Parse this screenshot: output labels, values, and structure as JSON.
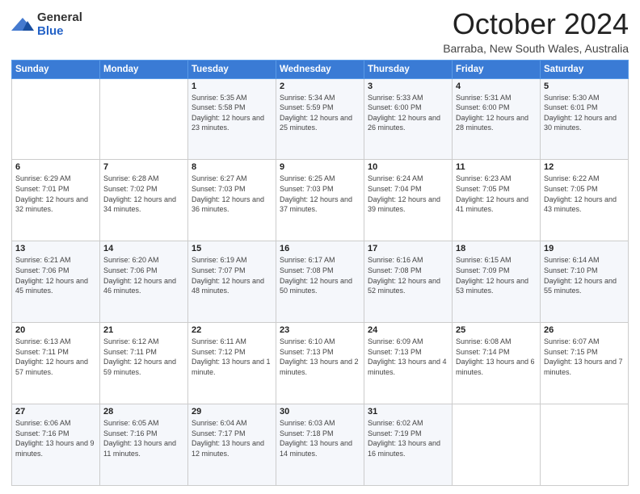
{
  "logo": {
    "general": "General",
    "blue": "Blue"
  },
  "header": {
    "month": "October 2024",
    "location": "Barraba, New South Wales, Australia"
  },
  "days_of_week": [
    "Sunday",
    "Monday",
    "Tuesday",
    "Wednesday",
    "Thursday",
    "Friday",
    "Saturday"
  ],
  "weeks": [
    [
      {
        "day": "",
        "sunrise": "",
        "sunset": "",
        "daylight": ""
      },
      {
        "day": "",
        "sunrise": "",
        "sunset": "",
        "daylight": ""
      },
      {
        "day": "1",
        "sunrise": "Sunrise: 5:35 AM",
        "sunset": "Sunset: 5:58 PM",
        "daylight": "Daylight: 12 hours and 23 minutes."
      },
      {
        "day": "2",
        "sunrise": "Sunrise: 5:34 AM",
        "sunset": "Sunset: 5:59 PM",
        "daylight": "Daylight: 12 hours and 25 minutes."
      },
      {
        "day": "3",
        "sunrise": "Sunrise: 5:33 AM",
        "sunset": "Sunset: 6:00 PM",
        "daylight": "Daylight: 12 hours and 26 minutes."
      },
      {
        "day": "4",
        "sunrise": "Sunrise: 5:31 AM",
        "sunset": "Sunset: 6:00 PM",
        "daylight": "Daylight: 12 hours and 28 minutes."
      },
      {
        "day": "5",
        "sunrise": "Sunrise: 5:30 AM",
        "sunset": "Sunset: 6:01 PM",
        "daylight": "Daylight: 12 hours and 30 minutes."
      }
    ],
    [
      {
        "day": "6",
        "sunrise": "Sunrise: 6:29 AM",
        "sunset": "Sunset: 7:01 PM",
        "daylight": "Daylight: 12 hours and 32 minutes."
      },
      {
        "day": "7",
        "sunrise": "Sunrise: 6:28 AM",
        "sunset": "Sunset: 7:02 PM",
        "daylight": "Daylight: 12 hours and 34 minutes."
      },
      {
        "day": "8",
        "sunrise": "Sunrise: 6:27 AM",
        "sunset": "Sunset: 7:03 PM",
        "daylight": "Daylight: 12 hours and 36 minutes."
      },
      {
        "day": "9",
        "sunrise": "Sunrise: 6:25 AM",
        "sunset": "Sunset: 7:03 PM",
        "daylight": "Daylight: 12 hours and 37 minutes."
      },
      {
        "day": "10",
        "sunrise": "Sunrise: 6:24 AM",
        "sunset": "Sunset: 7:04 PM",
        "daylight": "Daylight: 12 hours and 39 minutes."
      },
      {
        "day": "11",
        "sunrise": "Sunrise: 6:23 AM",
        "sunset": "Sunset: 7:05 PM",
        "daylight": "Daylight: 12 hours and 41 minutes."
      },
      {
        "day": "12",
        "sunrise": "Sunrise: 6:22 AM",
        "sunset": "Sunset: 7:05 PM",
        "daylight": "Daylight: 12 hours and 43 minutes."
      }
    ],
    [
      {
        "day": "13",
        "sunrise": "Sunrise: 6:21 AM",
        "sunset": "Sunset: 7:06 PM",
        "daylight": "Daylight: 12 hours and 45 minutes."
      },
      {
        "day": "14",
        "sunrise": "Sunrise: 6:20 AM",
        "sunset": "Sunset: 7:06 PM",
        "daylight": "Daylight: 12 hours and 46 minutes."
      },
      {
        "day": "15",
        "sunrise": "Sunrise: 6:19 AM",
        "sunset": "Sunset: 7:07 PM",
        "daylight": "Daylight: 12 hours and 48 minutes."
      },
      {
        "day": "16",
        "sunrise": "Sunrise: 6:17 AM",
        "sunset": "Sunset: 7:08 PM",
        "daylight": "Daylight: 12 hours and 50 minutes."
      },
      {
        "day": "17",
        "sunrise": "Sunrise: 6:16 AM",
        "sunset": "Sunset: 7:08 PM",
        "daylight": "Daylight: 12 hours and 52 minutes."
      },
      {
        "day": "18",
        "sunrise": "Sunrise: 6:15 AM",
        "sunset": "Sunset: 7:09 PM",
        "daylight": "Daylight: 12 hours and 53 minutes."
      },
      {
        "day": "19",
        "sunrise": "Sunrise: 6:14 AM",
        "sunset": "Sunset: 7:10 PM",
        "daylight": "Daylight: 12 hours and 55 minutes."
      }
    ],
    [
      {
        "day": "20",
        "sunrise": "Sunrise: 6:13 AM",
        "sunset": "Sunset: 7:11 PM",
        "daylight": "Daylight: 12 hours and 57 minutes."
      },
      {
        "day": "21",
        "sunrise": "Sunrise: 6:12 AM",
        "sunset": "Sunset: 7:11 PM",
        "daylight": "Daylight: 12 hours and 59 minutes."
      },
      {
        "day": "22",
        "sunrise": "Sunrise: 6:11 AM",
        "sunset": "Sunset: 7:12 PM",
        "daylight": "Daylight: 13 hours and 1 minute."
      },
      {
        "day": "23",
        "sunrise": "Sunrise: 6:10 AM",
        "sunset": "Sunset: 7:13 PM",
        "daylight": "Daylight: 13 hours and 2 minutes."
      },
      {
        "day": "24",
        "sunrise": "Sunrise: 6:09 AM",
        "sunset": "Sunset: 7:13 PM",
        "daylight": "Daylight: 13 hours and 4 minutes."
      },
      {
        "day": "25",
        "sunrise": "Sunrise: 6:08 AM",
        "sunset": "Sunset: 7:14 PM",
        "daylight": "Daylight: 13 hours and 6 minutes."
      },
      {
        "day": "26",
        "sunrise": "Sunrise: 6:07 AM",
        "sunset": "Sunset: 7:15 PM",
        "daylight": "Daylight: 13 hours and 7 minutes."
      }
    ],
    [
      {
        "day": "27",
        "sunrise": "Sunrise: 6:06 AM",
        "sunset": "Sunset: 7:16 PM",
        "daylight": "Daylight: 13 hours and 9 minutes."
      },
      {
        "day": "28",
        "sunrise": "Sunrise: 6:05 AM",
        "sunset": "Sunset: 7:16 PM",
        "daylight": "Daylight: 13 hours and 11 minutes."
      },
      {
        "day": "29",
        "sunrise": "Sunrise: 6:04 AM",
        "sunset": "Sunset: 7:17 PM",
        "daylight": "Daylight: 13 hours and 12 minutes."
      },
      {
        "day": "30",
        "sunrise": "Sunrise: 6:03 AM",
        "sunset": "Sunset: 7:18 PM",
        "daylight": "Daylight: 13 hours and 14 minutes."
      },
      {
        "day": "31",
        "sunrise": "Sunrise: 6:02 AM",
        "sunset": "Sunset: 7:19 PM",
        "daylight": "Daylight: 13 hours and 16 minutes."
      },
      {
        "day": "",
        "sunrise": "",
        "sunset": "",
        "daylight": ""
      },
      {
        "day": "",
        "sunrise": "",
        "sunset": "",
        "daylight": ""
      }
    ]
  ]
}
